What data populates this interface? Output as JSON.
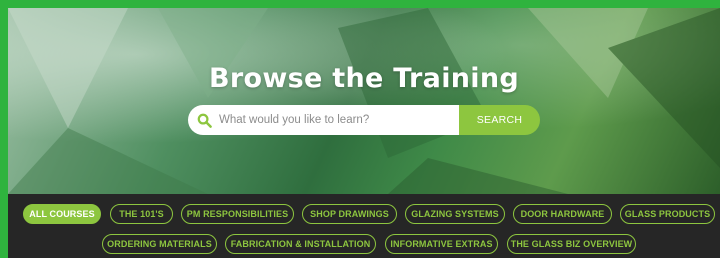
{
  "hero": {
    "title": "Browse the Training"
  },
  "search": {
    "placeholder": "What would you like to learn?",
    "button_label": "SEARCH",
    "icon": "search-icon"
  },
  "filters": {
    "active": "ALL COURSES",
    "row1": [
      {
        "label": "ALL COURSES",
        "active": true
      },
      {
        "label": "THE 101'S",
        "active": false
      },
      {
        "label": "PM RESPONSIBILITIES",
        "active": false
      },
      {
        "label": "SHOP DRAWINGS",
        "active": false
      },
      {
        "label": "GLAZING SYSTEMS",
        "active": false
      },
      {
        "label": "DOOR HARDWARE",
        "active": false
      },
      {
        "label": "GLASS PRODUCTS",
        "active": false
      }
    ],
    "row2": [
      {
        "label": "ORDERING MATERIALS",
        "active": false
      },
      {
        "label": "FABRICATION & INSTALLATION",
        "active": false
      },
      {
        "label": "INFORMATIVE EXTRAS",
        "active": false
      },
      {
        "label": "THE GLASS BIZ OVERVIEW",
        "active": false
      }
    ]
  },
  "colors": {
    "accent": "#8dc63f",
    "border_green": "#2fb33e",
    "filter_bg": "#262626"
  }
}
